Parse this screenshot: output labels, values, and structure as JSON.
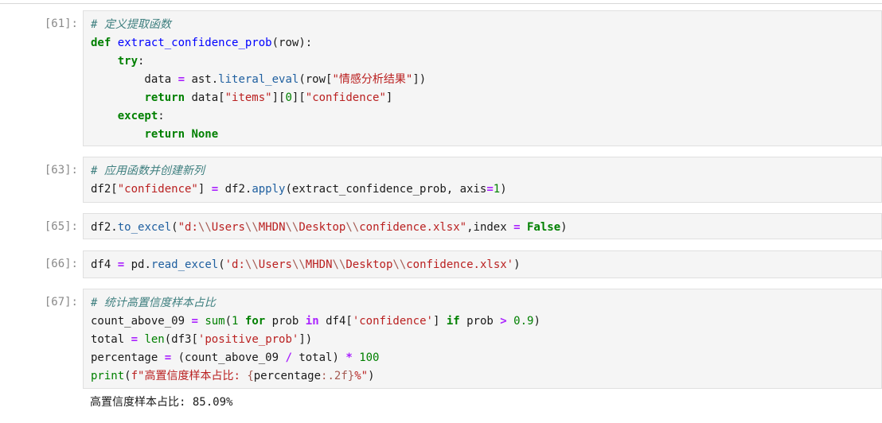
{
  "cells": [
    {
      "prompt": "[61]:",
      "lines": [
        [
          {
            "t": "# 定义提取函数",
            "c": "cm"
          }
        ],
        [
          {
            "t": "def",
            "c": "kw"
          },
          {
            "t": " ",
            "c": "pn"
          },
          {
            "t": "extract_confidence_prob",
            "c": "fn"
          },
          {
            "t": "(row):",
            "c": "pn"
          }
        ],
        [
          {
            "t": "    ",
            "c": "pn"
          },
          {
            "t": "try",
            "c": "kw"
          },
          {
            "t": ":",
            "c": "pn"
          }
        ],
        [
          {
            "t": "        data ",
            "c": "pn"
          },
          {
            "t": "=",
            "c": "op"
          },
          {
            "t": " ast",
            "c": "pn"
          },
          {
            "t": ".",
            "c": "pn"
          },
          {
            "t": "literal_eval",
            "c": "attr"
          },
          {
            "t": "(row[",
            "c": "pn"
          },
          {
            "t": "\"情感分析结果\"",
            "c": "str"
          },
          {
            "t": "])",
            "c": "pn"
          }
        ],
        [
          {
            "t": "        ",
            "c": "pn"
          },
          {
            "t": "return",
            "c": "kw"
          },
          {
            "t": " data[",
            "c": "pn"
          },
          {
            "t": "\"items\"",
            "c": "str"
          },
          {
            "t": "][",
            "c": "pn"
          },
          {
            "t": "0",
            "c": "num"
          },
          {
            "t": "][",
            "c": "pn"
          },
          {
            "t": "\"confidence\"",
            "c": "str"
          },
          {
            "t": "]",
            "c": "pn"
          }
        ],
        [
          {
            "t": "    ",
            "c": "pn"
          },
          {
            "t": "except",
            "c": "kw"
          },
          {
            "t": ":",
            "c": "pn"
          }
        ],
        [
          {
            "t": "        ",
            "c": "pn"
          },
          {
            "t": "return",
            "c": "kw"
          },
          {
            "t": " ",
            "c": "pn"
          },
          {
            "t": "None",
            "c": "kw"
          }
        ]
      ]
    },
    {
      "prompt": "[63]:",
      "lines": [
        [
          {
            "t": "# 应用函数并创建新列",
            "c": "cm"
          }
        ],
        [
          {
            "t": "df2[",
            "c": "pn"
          },
          {
            "t": "\"confidence\"",
            "c": "str"
          },
          {
            "t": "] ",
            "c": "pn"
          },
          {
            "t": "=",
            "c": "op"
          },
          {
            "t": " df2",
            "c": "pn"
          },
          {
            "t": ".",
            "c": "pn"
          },
          {
            "t": "apply",
            "c": "attr"
          },
          {
            "t": "(extract_confidence_prob, axis",
            "c": "pn"
          },
          {
            "t": "=",
            "c": "op"
          },
          {
            "t": "1",
            "c": "num"
          },
          {
            "t": ")",
            "c": "pn"
          }
        ]
      ]
    },
    {
      "prompt": "[65]:",
      "lines": [
        [
          {
            "t": "df2",
            "c": "pn"
          },
          {
            "t": ".",
            "c": "pn"
          },
          {
            "t": "to_excel",
            "c": "attr"
          },
          {
            "t": "(",
            "c": "pn"
          },
          {
            "t": "\"d:",
            "c": "str"
          },
          {
            "t": "\\\\",
            "c": "sint"
          },
          {
            "t": "Users",
            "c": "str"
          },
          {
            "t": "\\\\",
            "c": "sint"
          },
          {
            "t": "MHDN",
            "c": "str"
          },
          {
            "t": "\\\\",
            "c": "sint"
          },
          {
            "t": "Desktop",
            "c": "str"
          },
          {
            "t": "\\\\",
            "c": "sint"
          },
          {
            "t": "confidence.xlsx\"",
            "c": "str"
          },
          {
            "t": ",index ",
            "c": "pn"
          },
          {
            "t": "=",
            "c": "op"
          },
          {
            "t": " ",
            "c": "pn"
          },
          {
            "t": "False",
            "c": "kw"
          },
          {
            "t": ")",
            "c": "pn"
          }
        ]
      ]
    },
    {
      "prompt": "[66]:",
      "lines": [
        [
          {
            "t": "df4 ",
            "c": "pn"
          },
          {
            "t": "=",
            "c": "op"
          },
          {
            "t": " pd",
            "c": "pn"
          },
          {
            "t": ".",
            "c": "pn"
          },
          {
            "t": "read_excel",
            "c": "attr"
          },
          {
            "t": "(",
            "c": "pn"
          },
          {
            "t": "'d:",
            "c": "str"
          },
          {
            "t": "\\\\",
            "c": "sint"
          },
          {
            "t": "Users",
            "c": "str"
          },
          {
            "t": "\\\\",
            "c": "sint"
          },
          {
            "t": "MHDN",
            "c": "str"
          },
          {
            "t": "\\\\",
            "c": "sint"
          },
          {
            "t": "Desktop",
            "c": "str"
          },
          {
            "t": "\\\\",
            "c": "sint"
          },
          {
            "t": "confidence.xlsx'",
            "c": "str"
          },
          {
            "t": ")",
            "c": "pn"
          }
        ]
      ]
    },
    {
      "prompt": "[67]:",
      "lines": [
        [
          {
            "t": "# 统计高置信度样本占比",
            "c": "cm"
          }
        ],
        [
          {
            "t": "count_above_09 ",
            "c": "pn"
          },
          {
            "t": "=",
            "c": "op"
          },
          {
            "t": " ",
            "c": "pn"
          },
          {
            "t": "sum",
            "c": "bi"
          },
          {
            "t": "(",
            "c": "pn"
          },
          {
            "t": "1",
            "c": "num"
          },
          {
            "t": " ",
            "c": "pn"
          },
          {
            "t": "for",
            "c": "kw"
          },
          {
            "t": " prob ",
            "c": "pn"
          },
          {
            "t": "in",
            "c": "op"
          },
          {
            "t": " df4[",
            "c": "pn"
          },
          {
            "t": "'confidence'",
            "c": "str"
          },
          {
            "t": "] ",
            "c": "pn"
          },
          {
            "t": "if",
            "c": "kw"
          },
          {
            "t": " prob ",
            "c": "pn"
          },
          {
            "t": ">",
            "c": "op"
          },
          {
            "t": " ",
            "c": "pn"
          },
          {
            "t": "0.9",
            "c": "num"
          },
          {
            "t": ")",
            "c": "pn"
          }
        ],
        [
          {
            "t": "total ",
            "c": "pn"
          },
          {
            "t": "=",
            "c": "op"
          },
          {
            "t": " ",
            "c": "pn"
          },
          {
            "t": "len",
            "c": "bi"
          },
          {
            "t": "(df3[",
            "c": "pn"
          },
          {
            "t": "'positive_prob'",
            "c": "str"
          },
          {
            "t": "])",
            "c": "pn"
          }
        ],
        [
          {
            "t": "percentage ",
            "c": "pn"
          },
          {
            "t": "=",
            "c": "op"
          },
          {
            "t": " (count_above_09 ",
            "c": "pn"
          },
          {
            "t": "/",
            "c": "op"
          },
          {
            "t": " total) ",
            "c": "pn"
          },
          {
            "t": "*",
            "c": "op"
          },
          {
            "t": " ",
            "c": "pn"
          },
          {
            "t": "100",
            "c": "num"
          }
        ],
        [
          {
            "t": "print",
            "c": "bi"
          },
          {
            "t": "(",
            "c": "pn"
          },
          {
            "t": "f\"高置信度样本占比: ",
            "c": "str"
          },
          {
            "t": "{",
            "c": "sint"
          },
          {
            "t": "percentage",
            "c": "pn"
          },
          {
            "t": ":.2f",
            "c": "sint"
          },
          {
            "t": "}",
            "c": "sint"
          },
          {
            "t": "%\"",
            "c": "str"
          },
          {
            "t": ")",
            "c": "pn"
          }
        ]
      ]
    }
  ],
  "output": {
    "text": "高置信度样本占比: 85.09%"
  }
}
